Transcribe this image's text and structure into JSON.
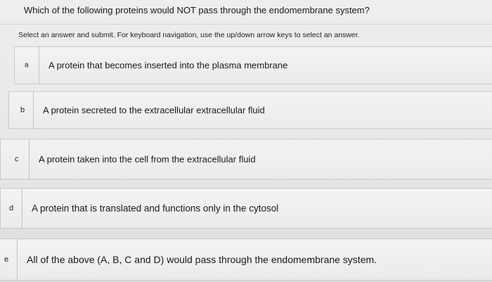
{
  "question": {
    "text": "Which of the following proteins would NOT pass through the endomembrane system?"
  },
  "instructions": {
    "text": "Select an answer and submit. For keyboard navigation, use the up/down arrow keys to select an answer."
  },
  "options": [
    {
      "letter": "a",
      "text": "A protein that becomes inserted into the plasma membrane"
    },
    {
      "letter": "b",
      "text": "A protein secreted to the extracellular extracellular fluid"
    },
    {
      "letter": "c",
      "text": "A protein taken into the cell from the extracellular fluid"
    },
    {
      "letter": "d",
      "text": "A protein that is translated and functions only in the cytosol"
    },
    {
      "letter": "e",
      "text": "All of the above (A, B, C and D) would pass through the endomembrane system."
    }
  ]
}
